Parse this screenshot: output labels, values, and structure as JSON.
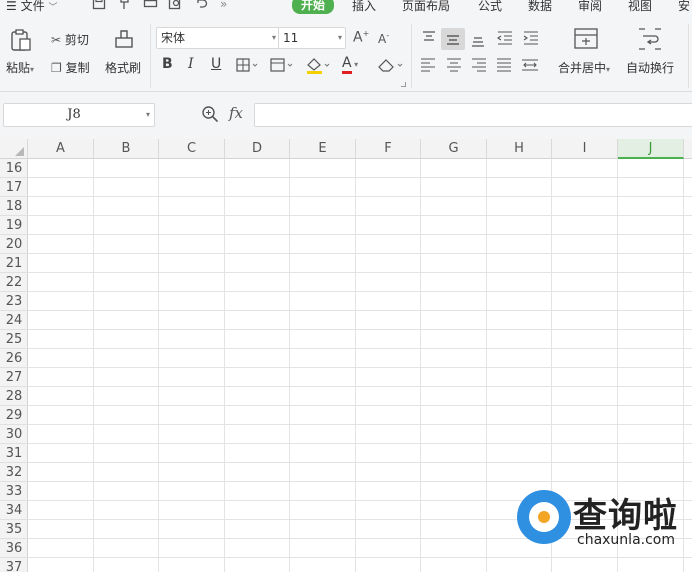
{
  "menu": {
    "file_label": "文件"
  },
  "tabs": [
    {
      "label": "开始"
    },
    {
      "label": "插入"
    },
    {
      "label": "页面布局"
    },
    {
      "label": "公式"
    },
    {
      "label": "数据"
    },
    {
      "label": "审阅"
    },
    {
      "label": "视图"
    },
    {
      "label": "安"
    }
  ],
  "ribbon": {
    "paste_label": "粘贴",
    "cut_label": "剪切",
    "copy_label": "复制",
    "format_painter_label": "格式刷",
    "font_name": "宋体",
    "font_size": "11",
    "bold": "B",
    "italic": "I",
    "underline": "U",
    "font_color_letter": "A",
    "merge_center_label": "合并居中",
    "wrap_text_label": "自动换行"
  },
  "formula_bar": {
    "cell_ref": "J8",
    "fx_label": "fx",
    "value": ""
  },
  "columns": [
    "A",
    "B",
    "C",
    "D",
    "E",
    "F",
    "G",
    "H",
    "I",
    "J"
  ],
  "selected_column": "J",
  "rows": [
    "16",
    "17",
    "18",
    "19",
    "20",
    "21",
    "22",
    "23",
    "24",
    "25",
    "26",
    "27",
    "28",
    "29",
    "30",
    "31",
    "32",
    "33",
    "34",
    "35",
    "36",
    "37"
  ],
  "watermark": {
    "name": "查询啦",
    "url": "chaxunla.com"
  },
  "colors": {
    "active_tab": "#4fb04f",
    "selected_column_text": "#3a9a3a",
    "logo_blue": "#2f8fe0",
    "logo_orange": "#f3a623"
  }
}
